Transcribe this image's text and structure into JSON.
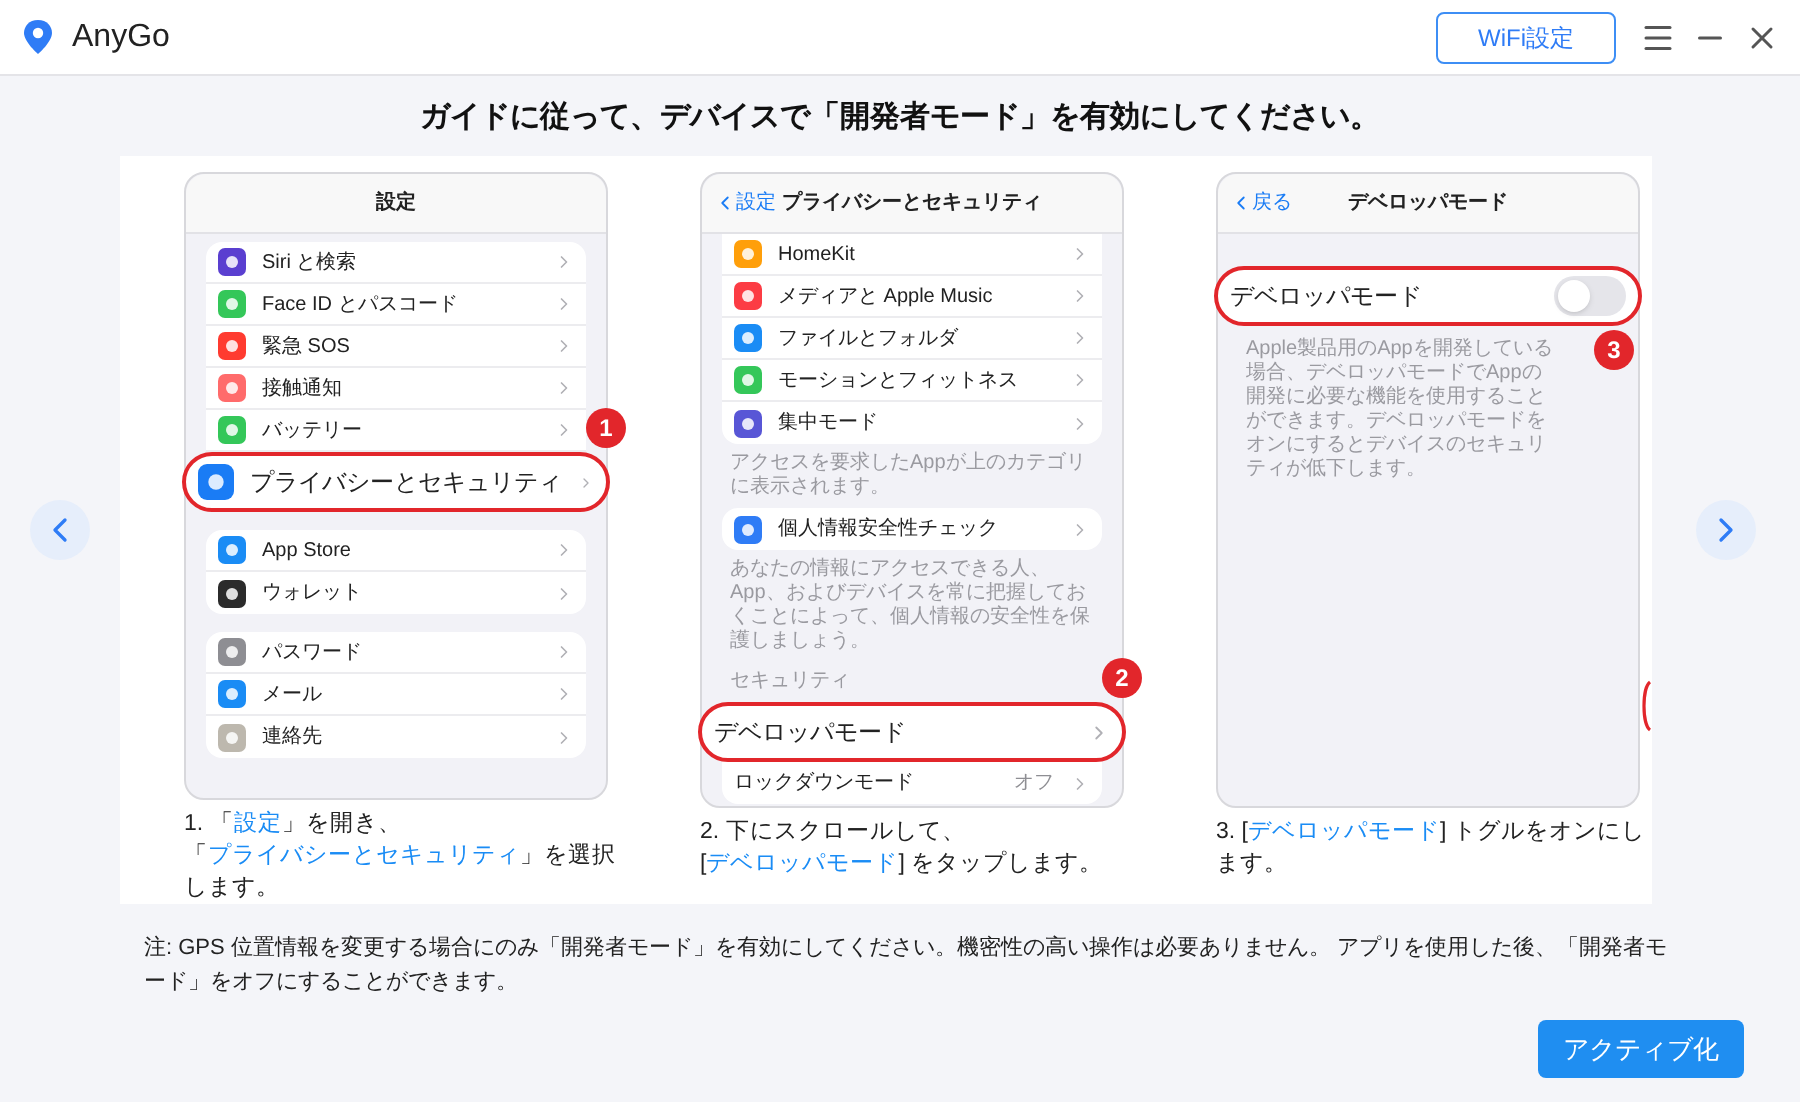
{
  "window": {
    "title": "AnyGo",
    "wifi_button": "WiFi設定"
  },
  "heading": "ガイドに従って、デバイスで「開発者モード」を有効にしてください。",
  "steps": [
    {
      "screen": {
        "title": "設定",
        "sections": [
          {
            "kind": "group",
            "items": [
              {
                "label": "Siri と検索",
                "kind": "link",
                "highlighted": false
              },
              {
                "label": "Face ID とパスコード",
                "kind": "link",
                "highlighted": false
              },
              {
                "label": "緊急 SOS",
                "kind": "link",
                "highlighted": false
              },
              {
                "label": "接触通知",
                "kind": "link",
                "highlighted": false
              },
              {
                "label": "バッテリー",
                "kind": "link",
                "highlighted": false
              },
              {
                "label": "プライバシーとセキュリティ",
                "kind": "link",
                "highlighted": true,
                "badge": "1"
              }
            ]
          },
          {
            "kind": "group",
            "items": [
              {
                "label": "App Store",
                "kind": "link",
                "highlighted": false
              },
              {
                "label": "ウォレット",
                "kind": "link",
                "highlighted": false
              }
            ]
          },
          {
            "kind": "group",
            "items": [
              {
                "label": "パスワード",
                "kind": "link",
                "highlighted": false
              },
              {
                "label": "メール",
                "kind": "link",
                "highlighted": false
              },
              {
                "label": "連絡先",
                "kind": "link",
                "highlighted": false
              }
            ]
          }
        ]
      },
      "caption": [
        {
          "text": "1. 「",
          "kind": "plain"
        },
        {
          "text": "設定",
          "kind": "link"
        },
        {
          "text": "」を開き、「",
          "kind": "plain"
        },
        {
          "text": "プライバシーとセキュリティ",
          "kind": "link"
        },
        {
          "text": "」を選択します。",
          "kind": "plain"
        }
      ]
    },
    {
      "screen": {
        "back": "設定",
        "title": "プライバシーとセキュリティ",
        "sections": [
          {
            "kind": "group",
            "items": [
              {
                "label": "HomeKit",
                "kind": "link",
                "highlighted": false
              },
              {
                "label": "メディアと Apple Music",
                "kind": "link",
                "highlighted": false
              },
              {
                "label": "ファイルとフォルダ",
                "kind": "link",
                "highlighted": false
              },
              {
                "label": "モーションとフィットネス",
                "kind": "link",
                "highlighted": false
              },
              {
                "label": "集中モード",
                "kind": "link",
                "highlighted": false
              }
            ]
          },
          {
            "kind": "footer",
            "text": "アクセスを要求したAppが上のカテゴリに表示されます。"
          },
          {
            "kind": "group",
            "items": [
              {
                "label": "個人情報安全性チェック",
                "kind": "link",
                "highlighted": false
              }
            ]
          },
          {
            "kind": "footer",
            "text": "あなたの情報にアクセスできる人、App、およびデバイスを常に把握しておくことによって、個人情報の安全性を保護しましょう。"
          },
          {
            "kind": "header",
            "text": "セキュリティ"
          },
          {
            "kind": "group",
            "items": [
              {
                "label": "デベロッパモード",
                "kind": "link",
                "highlighted": true,
                "badge": "2"
              },
              {
                "label": "ロックダウンモード",
                "kind": "link",
                "highlighted": false,
                "value": "オフ"
              }
            ]
          }
        ]
      },
      "caption": [
        {
          "text": "2. 下にスクロールして、[",
          "kind": "plain"
        },
        {
          "text": "デベロッパモード",
          "kind": "link"
        },
        {
          "text": "] をタップします。",
          "kind": "plain"
        }
      ]
    },
    {
      "screen": {
        "back": "戻る",
        "title": "デベロッパモード",
        "sections": [
          {
            "kind": "group",
            "items": [
              {
                "label": "デベロッパモード",
                "kind": "toggle",
                "highlighted": true,
                "on": false,
                "badge": "3"
              }
            ]
          },
          {
            "kind": "footer",
            "text": "Apple製品用のAppを開発している場合、デベロッパモードでAppの開発に必要な機能を使用することができます。デベロッパモードをオンにするとデバイスのセキュリティが低下します。"
          }
        ]
      },
      "caption": [
        {
          "text": "3. [",
          "kind": "plain"
        },
        {
          "text": "デベロッパモード",
          "kind": "link"
        },
        {
          "text": "] トグルをオンにします。",
          "kind": "plain"
        }
      ]
    }
  ],
  "note": "注: GPS 位置情報を変更する場合にのみ「開発者モード」を有効にしてください。機密性の高い操作は必要ありません。 アプリを使用した後、「開発者モード」をオフにすることができます。",
  "activate_button": "アクティブ化"
}
